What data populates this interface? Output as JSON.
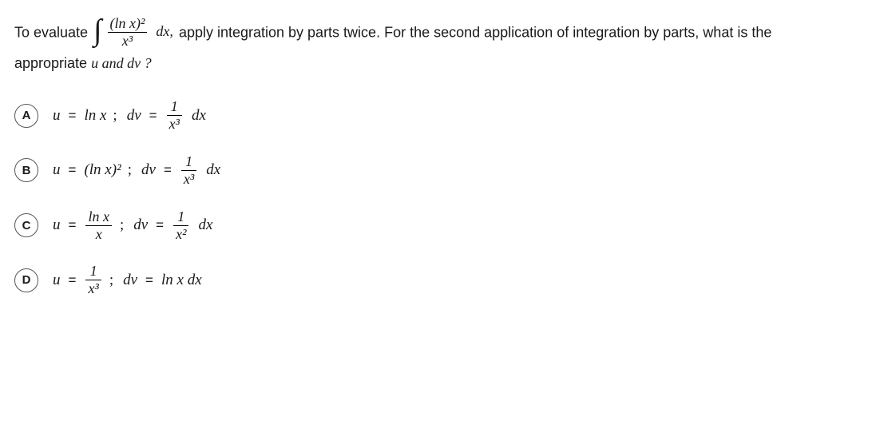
{
  "question": {
    "p1": "To evaluate",
    "integral_num": "(ln x)²",
    "integral_den": "x³",
    "p2": "dx,",
    "p3": "apply integration by parts twice. For the second application of integration by parts, what is the",
    "p4": "appropriate",
    "p5": "u and dv ?"
  },
  "options": [
    {
      "letter": "A",
      "u_lhs": "u",
      "u_rhs": "ln x",
      "dv_lhs": "dv",
      "frac_num": "1",
      "frac_den": "x³",
      "dv_tail": "dx"
    },
    {
      "letter": "B",
      "u_lhs": "u",
      "u_rhs": "(ln x)²",
      "dv_lhs": "dv",
      "frac_num": "1",
      "frac_den": "x³",
      "dv_tail": "dx"
    },
    {
      "letter": "C",
      "u_lhs": "u",
      "u_frac_num": "ln x",
      "u_frac_den": "x",
      "dv_lhs": "dv",
      "frac_num": "1",
      "frac_den": "x²",
      "dv_tail": "dx"
    },
    {
      "letter": "D",
      "u_lhs": "u",
      "u_frac_num": "1",
      "u_frac_den": "x³",
      "dv_lhs": "dv",
      "dv_rhs": "ln x dx"
    }
  ]
}
